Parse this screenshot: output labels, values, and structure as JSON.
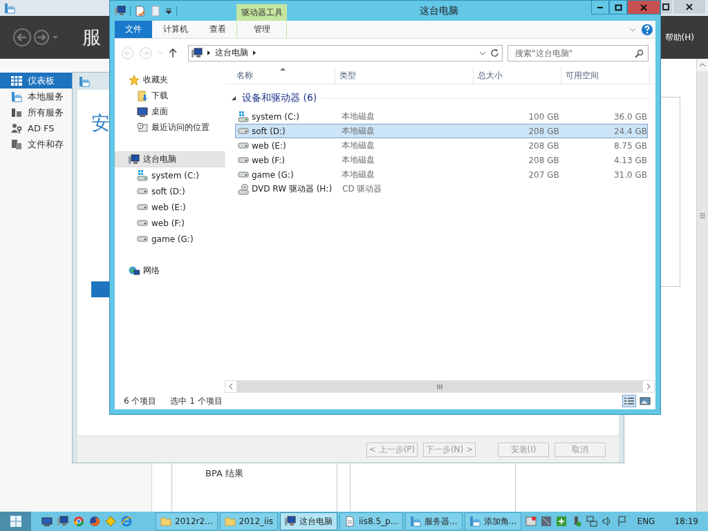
{
  "server_manager": {
    "header_title": "服",
    "help_menu": "帮助(H)",
    "nav": [
      {
        "label": "仪表板",
        "selected": true,
        "kind": "dashboard"
      },
      {
        "label": "本地服务",
        "selected": false,
        "kind": "server"
      },
      {
        "label": "所有服务",
        "selected": false,
        "kind": "servers"
      },
      {
        "label": "AD FS",
        "selected": false,
        "kind": "adfs"
      },
      {
        "label": "文件和存",
        "selected": false,
        "kind": "files"
      }
    ],
    "tile_text": "BPA 结果"
  },
  "wizard": {
    "heading": "安",
    "buttons": [
      {
        "label": "< 上一步(P)",
        "disabled": true
      },
      {
        "label": "下一步(N) >",
        "disabled": true
      },
      {
        "label": "安装(I)",
        "disabled": true
      },
      {
        "label": "取消",
        "disabled": true
      }
    ]
  },
  "explorer": {
    "title": "这台电脑",
    "context_group": "驱动器工具",
    "ribbon_tabs": [
      {
        "label": "文件",
        "kind": "file"
      },
      {
        "label": "计算机",
        "kind": "tab"
      },
      {
        "label": "查看",
        "kind": "tab"
      },
      {
        "label": "管理",
        "kind": "context"
      }
    ],
    "address": [
      "这台电脑"
    ],
    "search": {
      "placeholder": "搜索\"这台电脑\""
    },
    "nav": [
      {
        "label": "收藏夹",
        "kind": "favorites",
        "selected": false,
        "children": [
          {
            "label": "下载",
            "kind": "downloads",
            "selected": false
          },
          {
            "label": "桌面",
            "kind": "desktop",
            "selected": false
          },
          {
            "label": "最近访问的位置",
            "kind": "recent",
            "selected": false
          }
        ]
      },
      {
        "label": "这台电脑",
        "kind": "pc",
        "selected": true,
        "children": [
          {
            "label": "system (C:)",
            "kind": "system",
            "selected": false
          },
          {
            "label": "soft (D:)",
            "kind": "drive",
            "selected": false
          },
          {
            "label": "web (E:)",
            "kind": "drive",
            "selected": false
          },
          {
            "label": "web (F:)",
            "kind": "drive",
            "selected": false
          },
          {
            "label": "game (G:)",
            "kind": "drive",
            "selected": false
          }
        ]
      },
      {
        "label": "网络",
        "kind": "network",
        "selected": false
      }
    ],
    "columns": [
      "名称",
      "类型",
      "总大小",
      "可用空间"
    ],
    "group": "设备和驱动器 (6)",
    "rows": [
      {
        "name": "system (C:)",
        "type": "本地磁盘",
        "total": "100 GB",
        "free": "36.0 GB",
        "kind": "system",
        "selected": false
      },
      {
        "name": "soft (D:)",
        "type": "本地磁盘",
        "total": "208 GB",
        "free": "24.4 GB",
        "kind": "drive",
        "selected": true
      },
      {
        "name": "web (E:)",
        "type": "本地磁盘",
        "total": "208 GB",
        "free": "8.75 GB",
        "kind": "drive",
        "selected": false
      },
      {
        "name": "web (F:)",
        "type": "本地磁盘",
        "total": "208 GB",
        "free": "4.13 GB",
        "kind": "drive",
        "selected": false
      },
      {
        "name": "game (G:)",
        "type": "本地磁盘",
        "total": "207 GB",
        "free": "31.0 GB",
        "kind": "drive",
        "selected": false
      },
      {
        "name": "DVD RW 驱动器 (H:)",
        "type": "CD 驱动器",
        "kind": "dvd",
        "selected": false
      }
    ],
    "status": [
      "6 个项目",
      "选中 1 个项目"
    ],
    "views": [
      {
        "kind": "details",
        "selected": true
      },
      {
        "kind": "tiles",
        "selected": false
      }
    ]
  },
  "taskbar": {
    "tasks": [
      {
        "label": "2012r2...",
        "kind": "folder",
        "selected": false
      },
      {
        "label": "2012_iis",
        "kind": "folder",
        "selected": false
      },
      {
        "label": "这台电脑",
        "kind": "pc",
        "selected": true
      },
      {
        "label": "iis8.5_p...",
        "kind": "doc",
        "selected": false
      },
      {
        "label": "服务器...",
        "kind": "server",
        "selected": false
      },
      {
        "label": "添加角...",
        "kind": "server",
        "selected": false
      }
    ],
    "language": "ENG",
    "time": "18:19"
  }
}
